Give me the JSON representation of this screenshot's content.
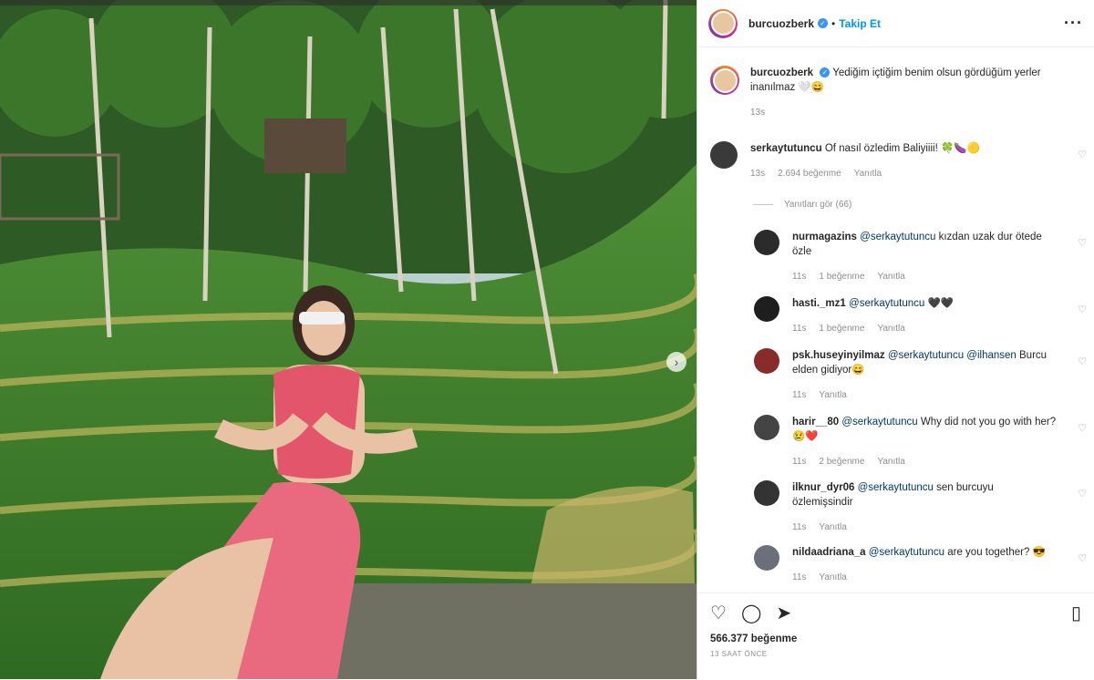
{
  "post": {
    "username": "burcuozberk",
    "follow_label": "Takip Et",
    "separator": "•",
    "more_icon": "more-horizontal-icon",
    "caption": "Yediğim içtiğim benim olsun gördüğüm yerler inanılmaz 🤍😄",
    "caption_time": "13s",
    "likes": "566.377 beğenme",
    "posted_ago": "13 SAAT ÖNCE"
  },
  "comments": [
    {
      "user": "serkaytutuncu",
      "mention": "",
      "text": "Of nasıl özledim Baliyiiii! 🍀🍆🟡",
      "time": "13s",
      "likes": "2.694 beğenme",
      "reply": "Yanıtla",
      "avatar": "#3a3a3a"
    },
    {
      "user": "nurmagazins",
      "mention": "@serkaytutuncu",
      "text": " kızdan uzak dur ötede özle",
      "time": "11s",
      "likes": "1 beğenme",
      "reply": "Yanıtla",
      "avatar": "#2b2b2b"
    },
    {
      "user": "hasti._mz1",
      "mention": "@serkaytutuncu",
      "text": " 🖤🖤",
      "time": "11s",
      "likes": "1 beğenme",
      "reply": "Yanıtla",
      "avatar": "#1e1e1e"
    },
    {
      "user": "psk.huseyinyilmaz",
      "mention": "@serkaytutuncu @ilhansen",
      "text": " Burcu elden gidiyor😄",
      "time": "11s",
      "likes": "",
      "reply": "Yanıtla",
      "avatar": "#8a2b2b"
    },
    {
      "user": "harir__80",
      "mention": "@serkaytutuncu",
      "text": " Why did not you go with her?😢❤️",
      "time": "11s",
      "likes": "2 beğenme",
      "reply": "Yanıtla",
      "avatar": "#444"
    },
    {
      "user": "ilknur_dyr06",
      "mention": "@serkaytutuncu",
      "text": " sen burcuyu özlemişsindir",
      "time": "11s",
      "likes": "",
      "reply": "Yanıtla",
      "avatar": "#333"
    },
    {
      "user": "nildaadriana_a",
      "mention": "@serkaytutuncu",
      "text": " are you together? 😎",
      "time": "11s",
      "likes": "",
      "reply": "Yanıtla",
      "avatar": "#6b6f7a"
    }
  ],
  "view_replies": "Yanıtları gör (66)",
  "icons": {
    "like": "heart-icon",
    "comment": "comment-icon",
    "share": "send-icon",
    "save": "bookmark-icon",
    "next": "chevron-right-icon"
  }
}
